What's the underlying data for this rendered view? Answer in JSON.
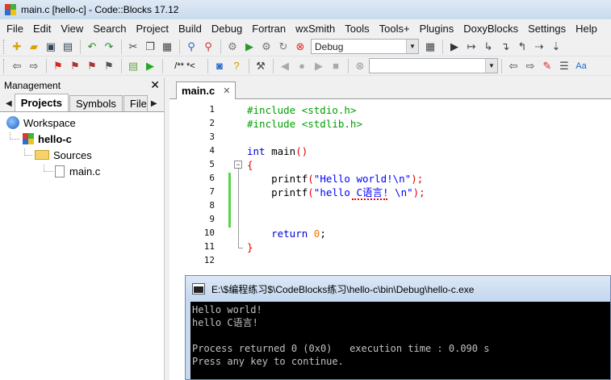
{
  "window": {
    "title": "main.c [hello-c] - Code::Blocks 17.12"
  },
  "menu": [
    "File",
    "Edit",
    "View",
    "Search",
    "Project",
    "Build",
    "Debug",
    "Fortran",
    "wxSmith",
    "Tools",
    "Tools+",
    "Plugins",
    "DoxyBlocks",
    "Settings",
    "Help"
  ],
  "toolbar": {
    "build_target": "Debug",
    "doxy_comment": "/** *<"
  },
  "management": {
    "title": "Management",
    "tabs": [
      "Projects",
      "Symbols",
      "Files"
    ],
    "tree": {
      "workspace": "Workspace",
      "project": "hello-c",
      "folder": "Sources",
      "file": "main.c"
    }
  },
  "editor": {
    "tab": "main.c",
    "lines": [
      {
        "n": "1"
      },
      {
        "n": "2"
      },
      {
        "n": "3"
      },
      {
        "n": "4"
      },
      {
        "n": "5"
      },
      {
        "n": "6"
      },
      {
        "n": "7"
      },
      {
        "n": "8"
      },
      {
        "n": "9"
      },
      {
        "n": "10"
      },
      {
        "n": "11"
      },
      {
        "n": "12"
      }
    ],
    "code": {
      "l1": "#include <stdio.h>",
      "l2": "#include <stdlib.h>",
      "l4_kw": "int",
      "l4_rest": " main",
      "l4_paren": "()",
      "l5": "{",
      "l6_fn": "    printf",
      "l6_open": "(",
      "l6_str": "\"Hello world!\\n\"",
      "l6_close": ");",
      "l7_fn": "    printf",
      "l7_open": "(",
      "l7_str": "\"hello C语言! \\n\"",
      "l7_close": ");",
      "l10_kw": "    return",
      "l10_num": " 0",
      "l10_end": ";",
      "l11": "}"
    }
  },
  "console": {
    "title": "E:\\$编程练习$\\CodeBlocks练习\\hello-c\\bin\\Debug\\hello-c.exe",
    "lines": [
      "Hello world!",
      "hello C语言!",
      "",
      "Process returned 0 (0x0)   execution time : 0.090 s",
      "Press any key to continue."
    ]
  }
}
